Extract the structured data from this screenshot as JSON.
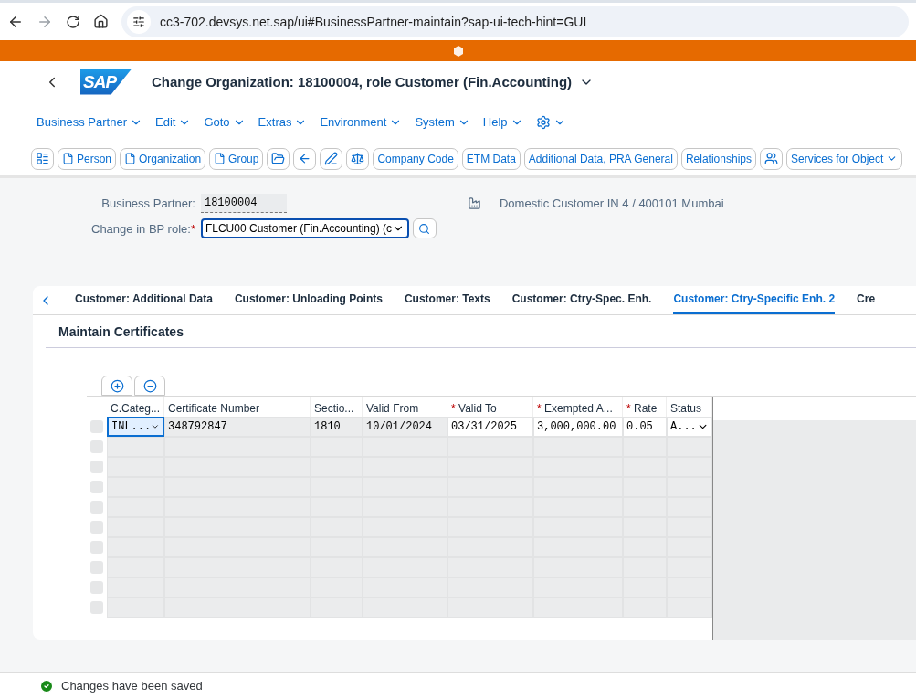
{
  "browser": {
    "url": "cc3-702.devsys.net.sap/ui#BusinessPartner-maintain?sap-ui-tech-hint=GUI"
  },
  "header": {
    "logo": "SAP",
    "title": "Change Organization: 18100004, role Customer (Fin.Accounting)"
  },
  "menu": [
    {
      "label": "Business Partner"
    },
    {
      "label": "Edit"
    },
    {
      "label": "Goto"
    },
    {
      "label": "Extras"
    },
    {
      "label": "Environment"
    },
    {
      "label": "System"
    },
    {
      "label": "Help"
    }
  ],
  "toolbar": [
    {
      "kind": "icon"
    },
    {
      "kind": "doc",
      "label": "Person"
    },
    {
      "kind": "doc",
      "label": "Organization"
    },
    {
      "kind": "doc",
      "label": "Group"
    },
    {
      "kind": "icon"
    },
    {
      "kind": "icon"
    },
    {
      "kind": "icon"
    },
    {
      "kind": "icon"
    },
    {
      "kind": "text",
      "label": "Company Code"
    },
    {
      "kind": "text",
      "label": "ETM Data"
    },
    {
      "kind": "text",
      "label": "Additional Data, PRA General"
    },
    {
      "kind": "text",
      "label": "Relationships"
    },
    {
      "kind": "icon"
    },
    {
      "kind": "menu",
      "label": "Services for Object"
    }
  ],
  "form": {
    "bp_label": "Business Partner:",
    "bp_value": "18100004",
    "bp_description": "Domestic Customer IN 4 / 400101 Mumbai",
    "role_label": "Change in BP role:",
    "role_marker": "*",
    "role_value": "FLCU00 Customer (Fin.Accounting) (c"
  },
  "tabs": [
    {
      "label": "Customer: Additional Data",
      "selected": false
    },
    {
      "label": "Customer: Unloading Points",
      "selected": false
    },
    {
      "label": "Customer: Texts",
      "selected": false
    },
    {
      "label": "Customer: Ctry-Spec. Enh.",
      "selected": false
    },
    {
      "label": "Customer: Ctry-Specific Enh. 2",
      "selected": true
    },
    {
      "label": "Cre",
      "selected": false
    }
  ],
  "section": {
    "title": "Maintain Certificates"
  },
  "table": {
    "columns": [
      {
        "label": "C.Categ...",
        "editable": true
      },
      {
        "label": "Certificate Number",
        "editable": false
      },
      {
        "label": "Sectio...",
        "editable": false
      },
      {
        "label": "Valid From",
        "editable": false
      },
      {
        "label": "Valid To",
        "marker": "*",
        "editable": true
      },
      {
        "label": "Exempted A...",
        "marker": "*",
        "editable": true
      },
      {
        "label": "Rate",
        "marker": "*",
        "editable": true
      },
      {
        "label": "Status",
        "editable": true
      }
    ],
    "rows": [
      {
        "selected": false,
        "cells": [
          {
            "text": "INL...",
            "kind": "dropdown",
            "focused": true
          },
          {
            "text": "348792847",
            "kind": "text",
            "focused": false
          },
          {
            "text": "1810",
            "kind": "text",
            "focused": false
          },
          {
            "text": "10/01/2024",
            "kind": "text",
            "focused": false
          },
          {
            "text": "03/31/2025",
            "kind": "text",
            "focused": false
          },
          {
            "text": "3,000,000.00",
            "kind": "text",
            "focused": false
          },
          {
            "text": "0.05",
            "kind": "text",
            "focused": false
          },
          {
            "text": "A...",
            "kind": "dropdown",
            "focused": false
          }
        ]
      }
    ]
  },
  "status_bar": {
    "message": "Changes have been saved"
  }
}
